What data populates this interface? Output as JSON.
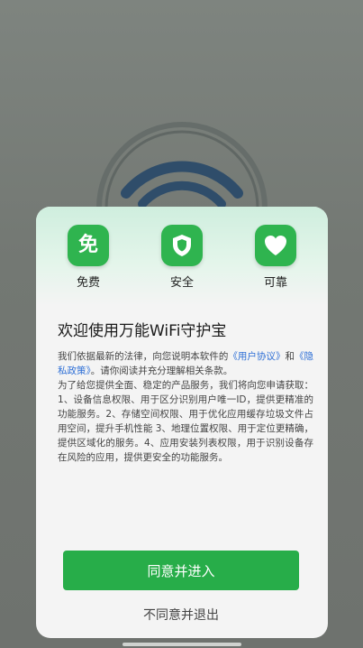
{
  "features": [
    {
      "icon": "免",
      "icon_name": "free-icon",
      "label": "免费"
    },
    {
      "icon": "shield",
      "icon_name": "shield-icon",
      "label": "安全"
    },
    {
      "icon": "heart",
      "icon_name": "heart-icon",
      "label": "可靠"
    }
  ],
  "dialog": {
    "title": "欢迎使用万能WiFi守护宝",
    "intro_pre": "我们依据最新的法律，向您说明本软件的",
    "user_agreement_link": "《用户协议》",
    "intro_and": "和",
    "privacy_link": "《隐私政策》",
    "intro_post": "。请你阅读并充分理解相关条款。",
    "permissions_text": "为了给您提供全面、稳定的产品服务，我们将向您申请获取：1、设备信息权限、用于区分识别用户唯一ID，提供更精准的功能服务。2、存储空间权限、用于优化应用缓存垃圾文件占用空间，提升手机性能 3、地理位置权限、用于定位更精确，提供区域化的服务。4、应用安装列表权限，用于识别设备存在风险的应用，提供更安全的功能服务。",
    "agree_label": "同意并进入",
    "decline_label": "不同意并退出"
  },
  "colors": {
    "accent": "#27ad49",
    "link": "#2e6fd6",
    "overlay": "#737873"
  }
}
